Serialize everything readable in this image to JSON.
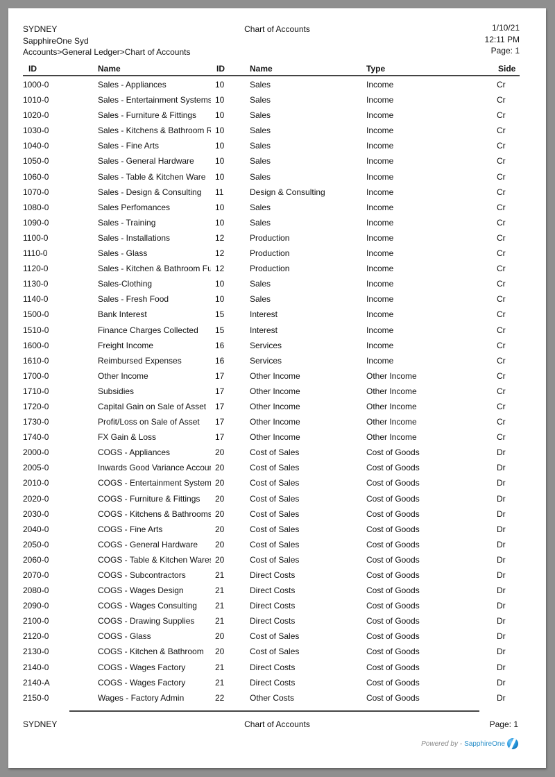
{
  "header": {
    "company": "SYDNEY",
    "branch": "SapphireOne Syd",
    "breadcrumb": "Accounts>General Ledger>Chart of Accounts",
    "title": "Chart of Accounts",
    "date": "1/10/21",
    "time": "12:11 PM",
    "page": "Page: 1"
  },
  "columns": {
    "id": "ID",
    "name": "Name",
    "group_id": "ID",
    "group_name": "Name",
    "type": "Type",
    "side": "Side"
  },
  "rows": [
    {
      "id": "1000-0",
      "name": "Sales - Appliances",
      "group_id": "10",
      "group_name": "Sales",
      "type": "Income",
      "side": "Cr"
    },
    {
      "id": "1010-0",
      "name": "Sales - Entertainment Systems",
      "group_id": "10",
      "group_name": "Sales",
      "type": "Income",
      "side": "Cr"
    },
    {
      "id": "1020-0",
      "name": "Sales - Furniture & Fittings",
      "group_id": "10",
      "group_name": "Sales",
      "type": "Income",
      "side": "Cr"
    },
    {
      "id": "1030-0",
      "name": "Sales - Kitchens & Bathroom R",
      "group_id": "10",
      "group_name": "Sales",
      "type": "Income",
      "side": "Cr"
    },
    {
      "id": "1040-0",
      "name": "Sales - Fine Arts",
      "group_id": "10",
      "group_name": "Sales",
      "type": "Income",
      "side": "Cr"
    },
    {
      "id": "1050-0",
      "name": "Sales - General Hardware",
      "group_id": "10",
      "group_name": "Sales",
      "type": "Income",
      "side": "Cr"
    },
    {
      "id": "1060-0",
      "name": "Sales - Table & Kitchen Ware",
      "group_id": "10",
      "group_name": "Sales",
      "type": "Income",
      "side": "Cr"
    },
    {
      "id": "1070-0",
      "name": "Sales - Design & Consulting",
      "group_id": "11",
      "group_name": "Design & Consulting",
      "type": "Income",
      "side": "Cr"
    },
    {
      "id": "1080-0",
      "name": "Sales Perfomances",
      "group_id": "10",
      "group_name": "Sales",
      "type": "Income",
      "side": "Cr"
    },
    {
      "id": "1090-0",
      "name": "Sales - Training",
      "group_id": "10",
      "group_name": "Sales",
      "type": "Income",
      "side": "Cr"
    },
    {
      "id": "1100-0",
      "name": "Sales - Installations",
      "group_id": "12",
      "group_name": "Production",
      "type": "Income",
      "side": "Cr"
    },
    {
      "id": "1110-0",
      "name": "Sales - Glass",
      "group_id": "12",
      "group_name": "Production",
      "type": "Income",
      "side": "Cr"
    },
    {
      "id": "1120-0",
      "name": "Sales - Kitchen & Bathroom Fu",
      "group_id": "12",
      "group_name": "Production",
      "type": "Income",
      "side": "Cr"
    },
    {
      "id": "1130-0",
      "name": "Sales-Clothing",
      "group_id": "10",
      "group_name": "Sales",
      "type": "Income",
      "side": "Cr"
    },
    {
      "id": "1140-0",
      "name": "Sales - Fresh Food",
      "group_id": "10",
      "group_name": "Sales",
      "type": "Income",
      "side": "Cr"
    },
    {
      "id": "1500-0",
      "name": "Bank Interest",
      "group_id": "15",
      "group_name": "Interest",
      "type": "Income",
      "side": "Cr"
    },
    {
      "id": "1510-0",
      "name": "Finance Charges Collected",
      "group_id": "15",
      "group_name": "Interest",
      "type": "Income",
      "side": "Cr"
    },
    {
      "id": "1600-0",
      "name": "Freight Income",
      "group_id": "16",
      "group_name": "Services",
      "type": "Income",
      "side": "Cr"
    },
    {
      "id": "1610-0",
      "name": "Reimbursed Expenses",
      "group_id": "16",
      "group_name": "Services",
      "type": "Income",
      "side": "Cr"
    },
    {
      "id": "1700-0",
      "name": "Other Income",
      "group_id": "17",
      "group_name": "Other Income",
      "type": "Other Income",
      "side": "Cr"
    },
    {
      "id": "1710-0",
      "name": "Subsidies",
      "group_id": "17",
      "group_name": "Other Income",
      "type": "Other Income",
      "side": "Cr"
    },
    {
      "id": "1720-0",
      "name": "Capital Gain on Sale of Asset",
      "group_id": "17",
      "group_name": "Other Income",
      "type": "Other Income",
      "side": "Cr"
    },
    {
      "id": "1730-0",
      "name": "Profit/Loss on Sale of Asset",
      "group_id": "17",
      "group_name": "Other Income",
      "type": "Other Income",
      "side": "Cr"
    },
    {
      "id": "1740-0",
      "name": "FX Gain & Loss",
      "group_id": "17",
      "group_name": "Other Income",
      "type": "Other Income",
      "side": "Cr"
    },
    {
      "id": "2000-0",
      "name": "COGS - Appliances",
      "group_id": "20",
      "group_name": "Cost of Sales",
      "type": "Cost of Goods",
      "side": "Dr"
    },
    {
      "id": "2005-0",
      "name": "Inwards Good Variance Accoun",
      "group_id": "20",
      "group_name": "Cost of Sales",
      "type": "Cost of Goods",
      "side": "Dr"
    },
    {
      "id": "2010-0",
      "name": "COGS - Entertainment Systems",
      "group_id": "20",
      "group_name": "Cost of Sales",
      "type": "Cost of Goods",
      "side": "Dr"
    },
    {
      "id": "2020-0",
      "name": "COGS - Furniture & Fittings",
      "group_id": "20",
      "group_name": "Cost of Sales",
      "type": "Cost of Goods",
      "side": "Dr"
    },
    {
      "id": "2030-0",
      "name": "COGS - Kitchens & Bathrooms",
      "group_id": "20",
      "group_name": "Cost of Sales",
      "type": "Cost of Goods",
      "side": "Dr"
    },
    {
      "id": "2040-0",
      "name": "COGS - Fine Arts",
      "group_id": "20",
      "group_name": "Cost of Sales",
      "type": "Cost of Goods",
      "side": "Dr"
    },
    {
      "id": "2050-0",
      "name": "COGS - General Hardware",
      "group_id": "20",
      "group_name": "Cost of Sales",
      "type": "Cost of Goods",
      "side": "Dr"
    },
    {
      "id": "2060-0",
      "name": "COGS - Table & Kitchen Wares",
      "group_id": "20",
      "group_name": "Cost of Sales",
      "type": "Cost of Goods",
      "side": "Dr"
    },
    {
      "id": "2070-0",
      "name": "COGS - Subcontractors",
      "group_id": "21",
      "group_name": "Direct Costs",
      "type": "Cost of Goods",
      "side": "Dr"
    },
    {
      "id": "2080-0",
      "name": "COGS - Wages Design",
      "group_id": "21",
      "group_name": "Direct Costs",
      "type": "Cost of Goods",
      "side": "Dr"
    },
    {
      "id": "2090-0",
      "name": "COGS - Wages Consulting",
      "group_id": "21",
      "group_name": "Direct Costs",
      "type": "Cost of Goods",
      "side": "Dr"
    },
    {
      "id": "2100-0",
      "name": "COGS - Drawing Supplies",
      "group_id": "21",
      "group_name": "Direct Costs",
      "type": "Cost of Goods",
      "side": "Dr"
    },
    {
      "id": "2120-0",
      "name": "COGS - Glass",
      "group_id": "20",
      "group_name": "Cost of Sales",
      "type": "Cost of Goods",
      "side": "Dr"
    },
    {
      "id": "2130-0",
      "name": "COGS - Kitchen & Bathroom",
      "group_id": "20",
      "group_name": "Cost of Sales",
      "type": "Cost of Goods",
      "side": "Dr"
    },
    {
      "id": "2140-0",
      "name": "COGS - Wages Factory",
      "group_id": "21",
      "group_name": "Direct Costs",
      "type": "Cost of Goods",
      "side": "Dr"
    },
    {
      "id": "2140-A",
      "name": "COGS - Wages Factory",
      "group_id": "21",
      "group_name": "Direct Costs",
      "type": "Cost of Goods",
      "side": "Dr"
    },
    {
      "id": "2150-0",
      "name": "Wages - Factory Admin",
      "group_id": "22",
      "group_name": "Other Costs",
      "type": "Cost of Goods",
      "side": "Dr"
    }
  ],
  "footer": {
    "company": "SYDNEY",
    "title": "Chart of Accounts",
    "page": "Page: 1",
    "powered_by": "Powered by -",
    "brand": "SapphireOne",
    "logo_icon": "sapphireone-logo-icon"
  },
  "colors": {
    "background": "#8f8f8f",
    "page": "#ffffff",
    "brand": "#2a8fc9"
  }
}
